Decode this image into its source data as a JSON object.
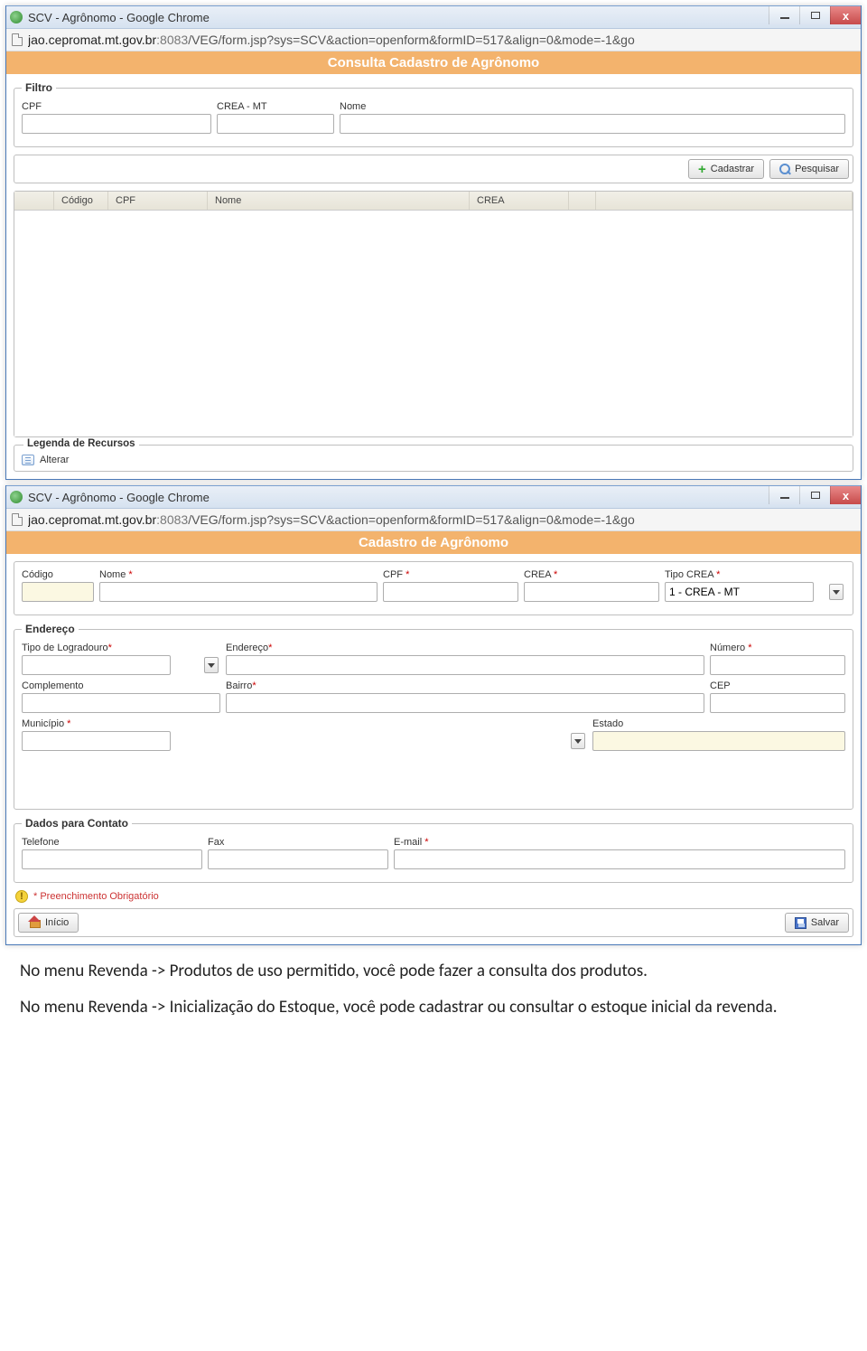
{
  "window1": {
    "title": "SCV - Agrônomo - Google Chrome",
    "url_host": "jao.cepromat.mt.gov.br",
    "url_port": ":8083",
    "url_path": "/VEG/form.jsp?sys=SCV&action=openform&formID=517&align=0&mode=-1&go",
    "header": "Consulta Cadastro de Agrônomo",
    "filtro": {
      "legend": "Filtro",
      "cpf_label": "CPF",
      "crea_label": "CREA - MT",
      "nome_label": "Nome"
    },
    "buttons": {
      "cadastrar": "Cadastrar",
      "pesquisar": "Pesquisar"
    },
    "grid": {
      "col_codigo": "Código",
      "col_cpf": "CPF",
      "col_nome": "Nome",
      "col_crea": "CREA"
    },
    "legenda": {
      "title": "Legenda de Recursos",
      "alterar": "Alterar"
    }
  },
  "window2": {
    "title": "SCV - Agrônomo - Google Chrome",
    "url_host": "jao.cepromat.mt.gov.br",
    "url_port": ":8083",
    "url_path": "/VEG/form.jsp?sys=SCV&action=openform&formID=517&align=0&mode=-1&go",
    "header": "Cadastro de Agrônomo",
    "main": {
      "codigo": "Código",
      "nome": "Nome",
      "cpf": "CPF",
      "crea": "CREA",
      "tipo_crea": "Tipo CREA",
      "tipo_crea_value": "1 - CREA - MT"
    },
    "endereco": {
      "legend": "Endereço",
      "tipo_log": "Tipo de Logradouro",
      "endereco": "Endereço",
      "numero": "Número",
      "complemento": "Complemento",
      "bairro": "Bairro",
      "cep": "CEP",
      "municipio": "Município",
      "estado": "Estado"
    },
    "contato": {
      "legend": "Dados para Contato",
      "telefone": "Telefone",
      "fax": "Fax",
      "email": "E-mail"
    },
    "required_note": "* Preenchimento Obrigatório",
    "footer": {
      "inicio": "Início",
      "salvar": "Salvar"
    }
  },
  "body_text": {
    "p1": "No menu Revenda -> Produtos de uso permitido, você pode fazer a consulta dos produtos.",
    "p2": "No menu Revenda -> Inicialização do Estoque, você pode cadastrar ou consultar o estoque inicial da revenda."
  }
}
